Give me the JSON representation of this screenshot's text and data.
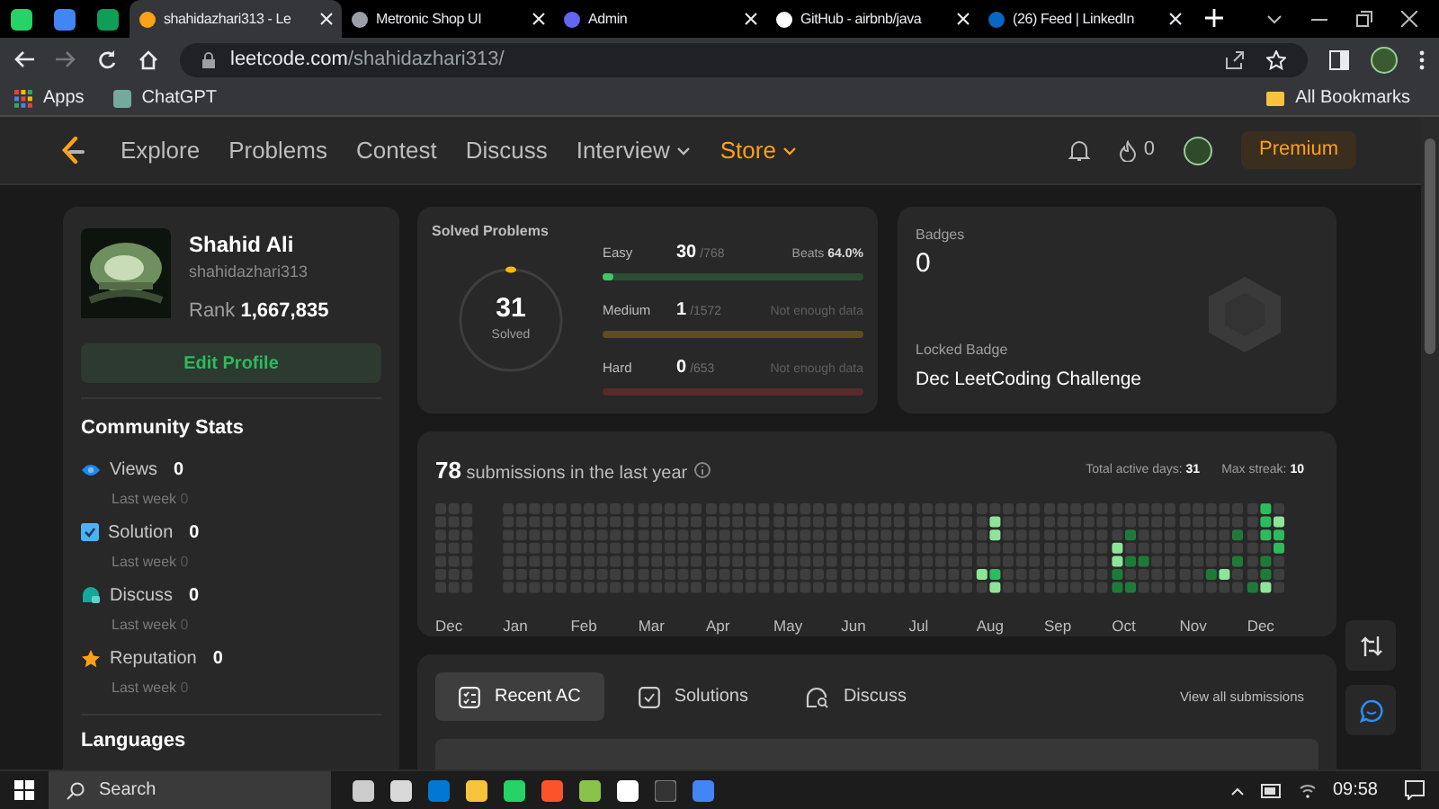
{
  "browser": {
    "tabs": [
      {
        "title": "shahidazhari313 - Le",
        "selected": true
      },
      {
        "title": "Metronic Shop UI",
        "selected": false
      },
      {
        "title": "Admin",
        "selected": false
      },
      {
        "title": "GitHub - airbnb/java",
        "selected": false
      },
      {
        "title": "(26) Feed | LinkedIn",
        "selected": false
      }
    ],
    "address": {
      "host": "leetcode.com",
      "path": "/shahidazhari313/"
    },
    "bookmarks": [
      "Apps",
      "ChatGPT"
    ],
    "all_bookmarks": "All Bookmarks"
  },
  "nav": {
    "items": [
      {
        "label": "Explore",
        "dropdown": false,
        "highlight": false
      },
      {
        "label": "Problems",
        "dropdown": false,
        "highlight": false
      },
      {
        "label": "Contest",
        "dropdown": false,
        "highlight": false
      },
      {
        "label": "Discuss",
        "dropdown": false,
        "highlight": false
      },
      {
        "label": "Interview",
        "dropdown": true,
        "highlight": false
      },
      {
        "label": "Store",
        "dropdown": true,
        "highlight": true
      }
    ],
    "streak": "0",
    "premium": "Premium"
  },
  "profile": {
    "name": "Shahid Ali",
    "username": "shahidazhari313",
    "rank_label": "Rank",
    "rank": "1,667,835",
    "edit_button": "Edit Profile"
  },
  "community_stats": {
    "title": "Community Stats",
    "items": [
      {
        "kind": "views",
        "label": "Views",
        "value": "0",
        "sub_label": "Last week",
        "sub_value": "0"
      },
      {
        "kind": "solution",
        "label": "Solution",
        "value": "0",
        "sub_label": "Last week",
        "sub_value": "0"
      },
      {
        "kind": "discuss",
        "label": "Discuss",
        "value": "0",
        "sub_label": "Last week",
        "sub_value": "0"
      },
      {
        "kind": "reputation",
        "label": "Reputation",
        "value": "0",
        "sub_label": "Last week",
        "sub_value": "0"
      }
    ]
  },
  "languages_title": "Languages",
  "solved": {
    "title": "Solved Problems",
    "total": "31",
    "total_label": "Solved",
    "levels": [
      {
        "name": "Easy",
        "solved": "30",
        "total": "/768",
        "note_label": "Beats",
        "note_value": "64.0%",
        "level": 0.04,
        "color": "#294d35"
      },
      {
        "name": "Medium",
        "solved": "1",
        "total": "/1572",
        "note_label": "Not enough data",
        "level": 0.0,
        "color": "#5e4e1f"
      },
      {
        "name": "Hard",
        "solved": "0",
        "total": "/653",
        "note_label": "Not enough data",
        "level": 0.0,
        "color": "#5a2a2a"
      }
    ]
  },
  "badges": {
    "title": "Badges",
    "count": "0",
    "locked_label": "Locked Badge",
    "locked_name": "Dec LeetCoding Challenge"
  },
  "submissions": {
    "count": "78",
    "text": "submissions in the last year",
    "active_label": "Total active days:",
    "active_value": "31",
    "streak_label": "Max streak:",
    "streak_value": "10",
    "months": [
      "Dec",
      "Jan",
      "Feb",
      "Mar",
      "Apr",
      "May",
      "Jun",
      "Jul",
      "Aug",
      "Sep",
      "Oct",
      "Nov",
      "Dec"
    ]
  },
  "activity_tabs": [
    {
      "kind": "recent",
      "label": "Recent AC",
      "selected": true
    },
    {
      "kind": "solutions",
      "label": "Solutions",
      "selected": false
    },
    {
      "kind": "discuss",
      "label": "Discuss",
      "selected": false
    }
  ],
  "view_all": "View all submissions",
  "taskbar": {
    "search_placeholder": "Search",
    "time": "09:58"
  }
}
